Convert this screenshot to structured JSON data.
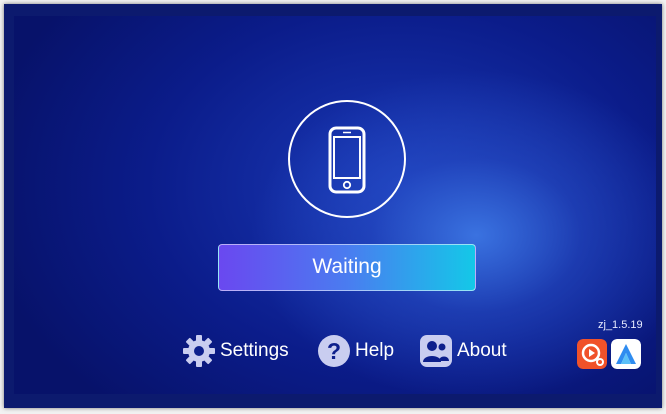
{
  "status": {
    "label": "Waiting"
  },
  "nav": {
    "settings_label": "Settings",
    "help_label": "Help",
    "about_label": "About"
  },
  "version": "zj_1.5.19",
  "icons": {
    "phone": "phone-icon",
    "settings": "gear-icon",
    "help": "question-icon",
    "about": "people-icon",
    "app1": "cast-app-icon",
    "app2": "android-auto-icon"
  },
  "colors": {
    "background": "#0b1c8a",
    "button_start": "#6a48f0",
    "button_end": "#14c8e8",
    "nav_icon": "#c9cdf0",
    "app1": "#f0522a",
    "app2": "#ffffff"
  }
}
